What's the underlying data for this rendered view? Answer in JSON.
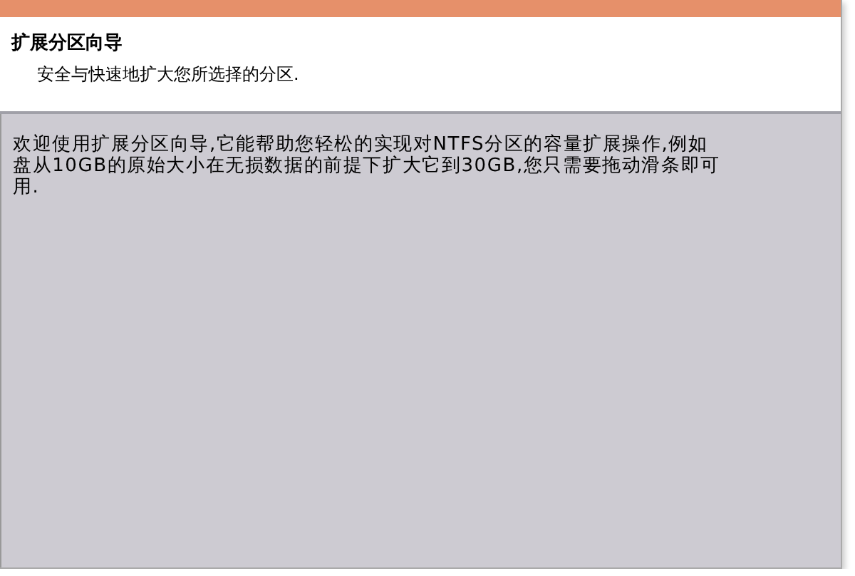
{
  "header": {
    "title": "扩展分区向导",
    "subtitle": "安全与快速地扩大您所选择的分区."
  },
  "body": {
    "lines": [
      "欢迎使用扩展分区向导,它能帮助您轻松的实现对NTFS分区的容量扩展操作,例如",
      "盘从10GB的原始大小在无损数据的前提下扩大它到30GB,您只需要拖动滑条即可",
      "用."
    ]
  }
}
